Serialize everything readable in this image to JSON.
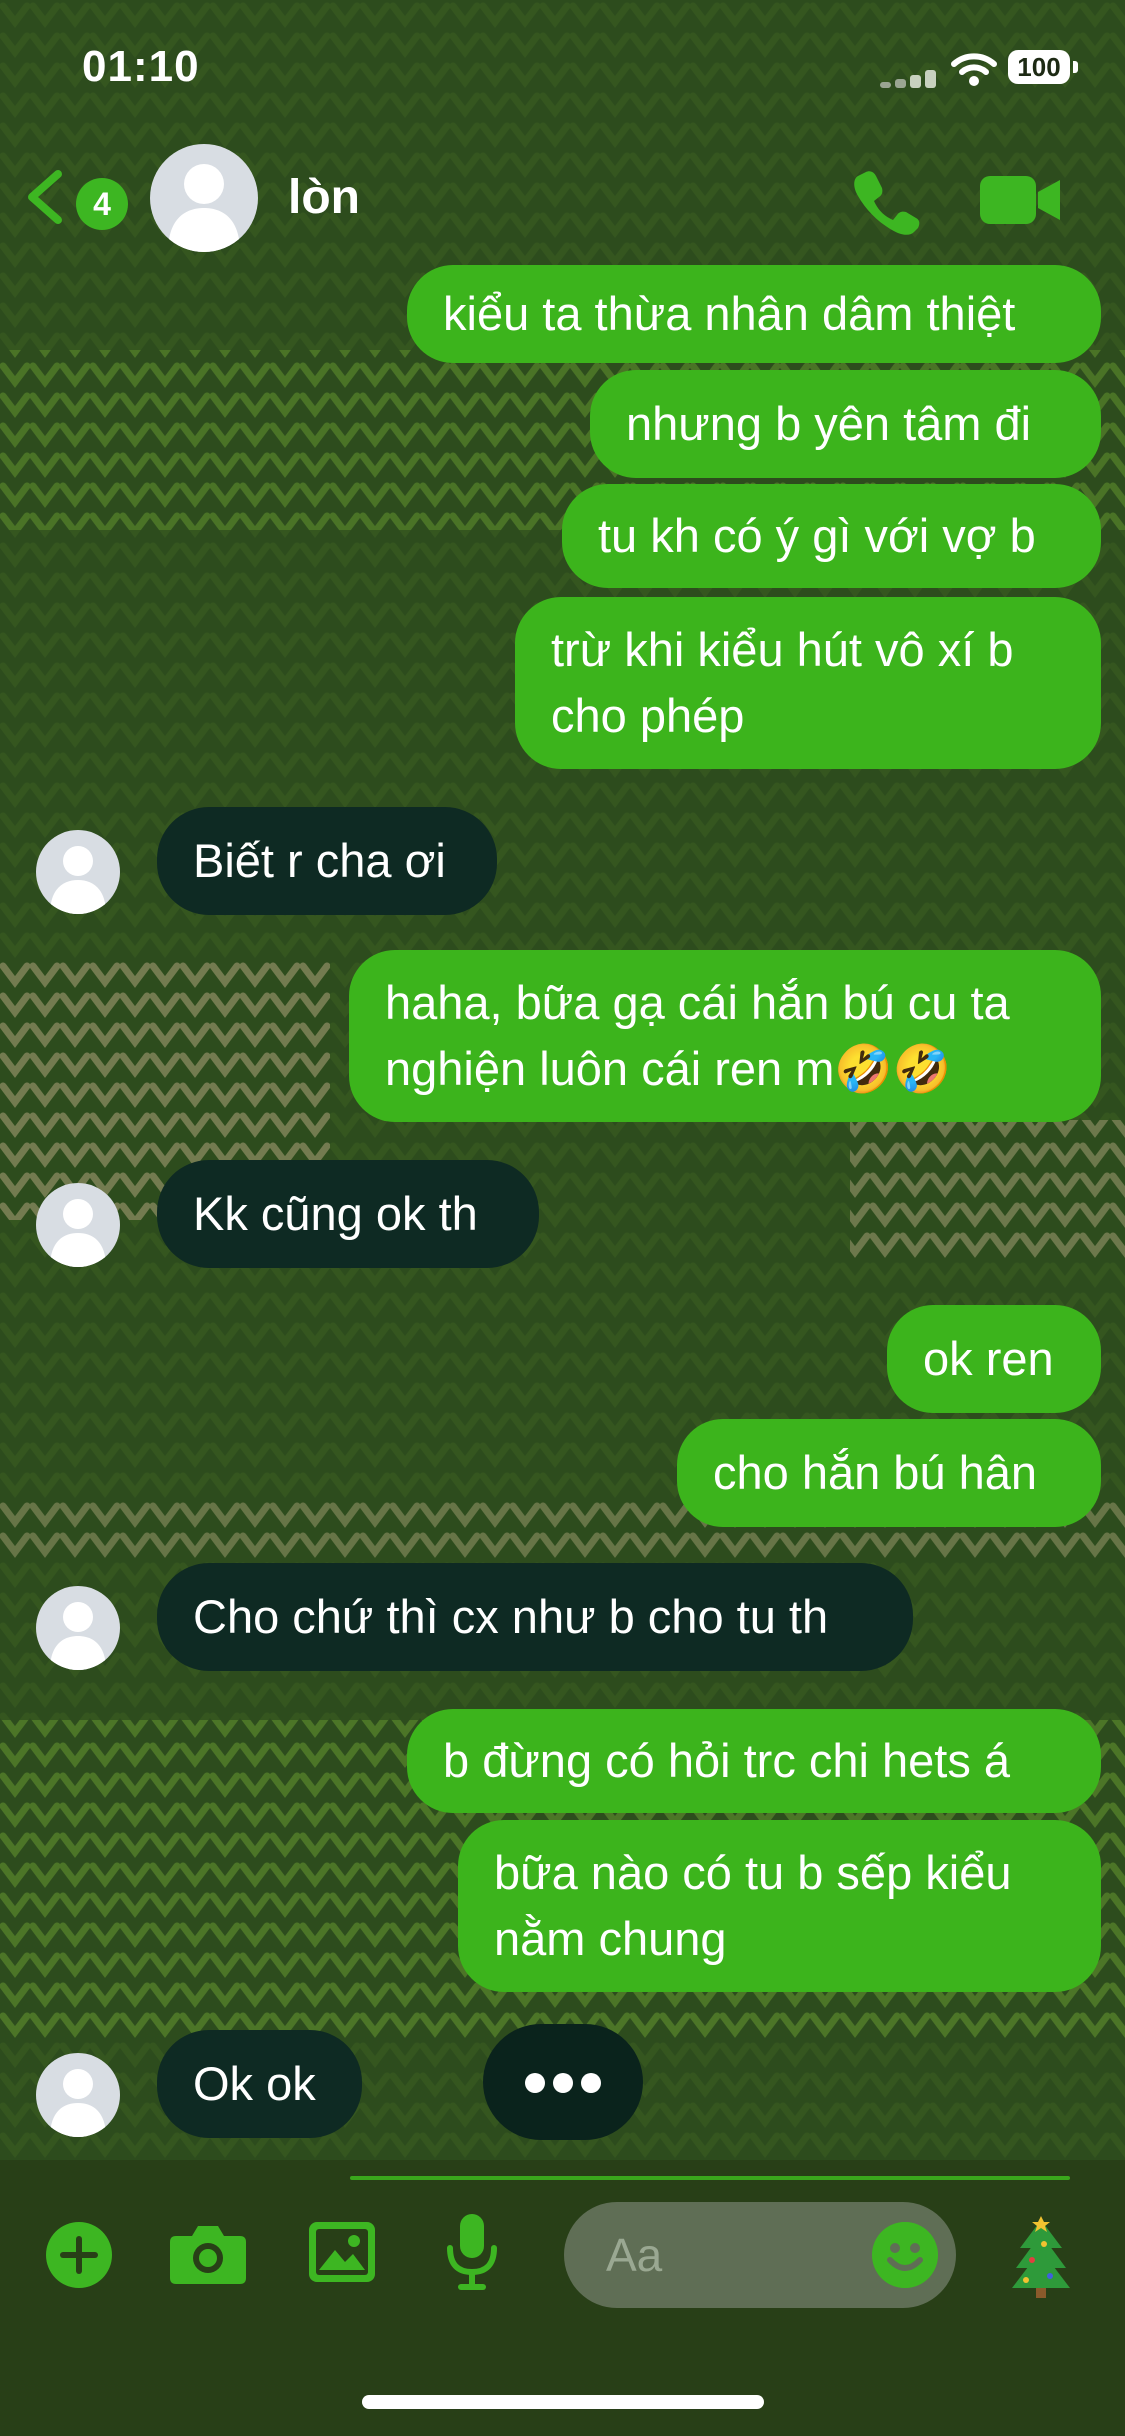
{
  "status_bar": {
    "time": "01:10",
    "battery": "100"
  },
  "header": {
    "back_badge": "4",
    "contact_name": "lòn"
  },
  "messages": [
    {
      "dir": "out",
      "text": "kiểu ta thừa nhân dâm thiệt"
    },
    {
      "dir": "out",
      "text": "nhưng b yên tâm đi"
    },
    {
      "dir": "out",
      "text": "tu kh có ý gì với vợ b"
    },
    {
      "dir": "out",
      "text": "trừ khi kiểu hút vô xí b\ncho phép"
    },
    {
      "dir": "in",
      "text": "Biết r cha ơi"
    },
    {
      "dir": "out",
      "text": "haha, bữa gạ cái hắn bú cu ta\nnghiện luôn cái ren m🤣🤣"
    },
    {
      "dir": "in",
      "text": "Kk cũng ok th"
    },
    {
      "dir": "out",
      "text": "ok ren"
    },
    {
      "dir": "out",
      "text": "cho hắn bú hân"
    },
    {
      "dir": "in",
      "text": "Cho chứ thì cx như b cho tu th"
    },
    {
      "dir": "out",
      "text": "b đừng có hỏi trc chi hets á"
    },
    {
      "dir": "out",
      "text": "bữa nào có tu b sếp kiểu\nnằm chung"
    },
    {
      "dir": "in",
      "text": "Ok ok"
    }
  ],
  "composer": {
    "placeholder": "Aa"
  },
  "colors": {
    "outgoing": "#3cb41c",
    "incoming": "#0e2a23",
    "accent": "#3db622",
    "background": "#2d4c1d"
  },
  "icons": [
    "back-chevron-icon",
    "phone-icon",
    "video-camera-icon",
    "plus-icon",
    "camera-icon",
    "image-icon",
    "microphone-icon",
    "emoji-icon",
    "christmas-tree-icon"
  ]
}
